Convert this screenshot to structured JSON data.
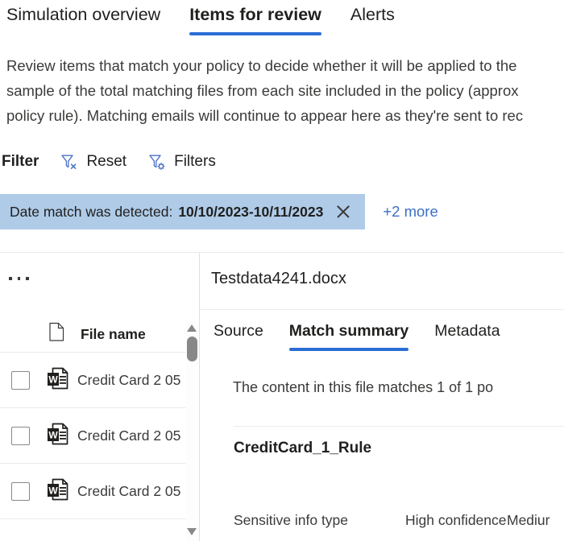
{
  "tabs": [
    {
      "label": "Simulation overview",
      "active": false
    },
    {
      "label": "Items for review",
      "active": true
    },
    {
      "label": "Alerts",
      "active": false
    }
  ],
  "description": {
    "line1": "Review items that match your policy to decide whether it will be applied to the",
    "line2": "sample of the total matching files from each site included in the policy (approx",
    "line3": "policy rule). Matching emails will continue to appear here as they're sent to rec"
  },
  "filter_toolbar": {
    "label": "Filter",
    "reset_label": "Reset",
    "reset_icon": "funnel-x-icon",
    "filters_label": "Filters",
    "filters_icon": "funnel-gear-icon"
  },
  "filter_pill": {
    "key": "Date match was detected:",
    "value": "10/10/2023-10/11/2023",
    "remove_icon": "close-icon",
    "more_label": "+2 more",
    "background": "#afcbe8",
    "link_color": "#3c6fc6"
  },
  "list_pane": {
    "overflow_icon": "ellipsis-icon",
    "header": {
      "icon": "document-icon",
      "label": "File name"
    },
    "rows": [
      {
        "name": "Credit Card 2 05",
        "icon": "word-document-icon",
        "checked": false
      },
      {
        "name": "Credit Card 2 05",
        "icon": "word-document-icon",
        "checked": false
      },
      {
        "name": "Credit Card 2 05",
        "icon": "word-document-icon",
        "checked": false
      }
    ],
    "scrollbar": {
      "up_icon": "scroll-up-arrow-icon",
      "down_icon": "scroll-down-arrow-icon"
    }
  },
  "detail_pane": {
    "title": "Testdata4241.docx",
    "tabs": [
      {
        "label": "Source",
        "active": false
      },
      {
        "label": "Match summary",
        "active": true
      },
      {
        "label": "Metadata",
        "active": false
      }
    ],
    "match_sentence": "The content in this file matches 1 of 1 po",
    "rule_name": "CreditCard_1_Rule",
    "sit_table": {
      "columns": [
        "Sensitive info type",
        "High confidence",
        "Mediur"
      ]
    }
  },
  "theme": {
    "accent": "#2b6ed4",
    "text": "#201f1e",
    "muted_text": "#3b3a39",
    "divider": "#edebe9"
  }
}
